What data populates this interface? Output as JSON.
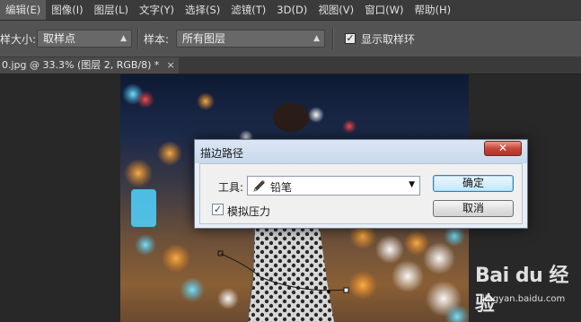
{
  "menu": {
    "items": [
      "编辑(E)",
      "图像(I)",
      "图层(L)",
      "文字(Y)",
      "选择(S)",
      "滤镜(T)",
      "3D(D)",
      "视图(V)",
      "窗口(W)",
      "帮助(H)"
    ],
    "active_index": 0
  },
  "options": {
    "sample_size_label": "样大小:",
    "sample_size_value": "取样点",
    "sample_label": "样本:",
    "sample_value": "所有图层",
    "show_ring_label": "显示取样环",
    "show_ring_checked": true
  },
  "document_tab": {
    "title": "0.jpg @ 33.3% (图层 2, RGB/8) *",
    "close_glyph": "×"
  },
  "dialog": {
    "title": "描边路径",
    "close_glyph": "✕",
    "tool_label": "工具:",
    "tool_value": "铅笔",
    "pressure_label": "模拟压力",
    "pressure_checked": true,
    "ok_label": "确定",
    "cancel_label": "取消"
  },
  "watermark": {
    "brand": "Bai du 经验",
    "url": "jingyan.baidu.com"
  },
  "icons": {
    "tool_icon": "pencil-icon",
    "check_mark": "✓",
    "dropdown_arrow": "▼"
  }
}
